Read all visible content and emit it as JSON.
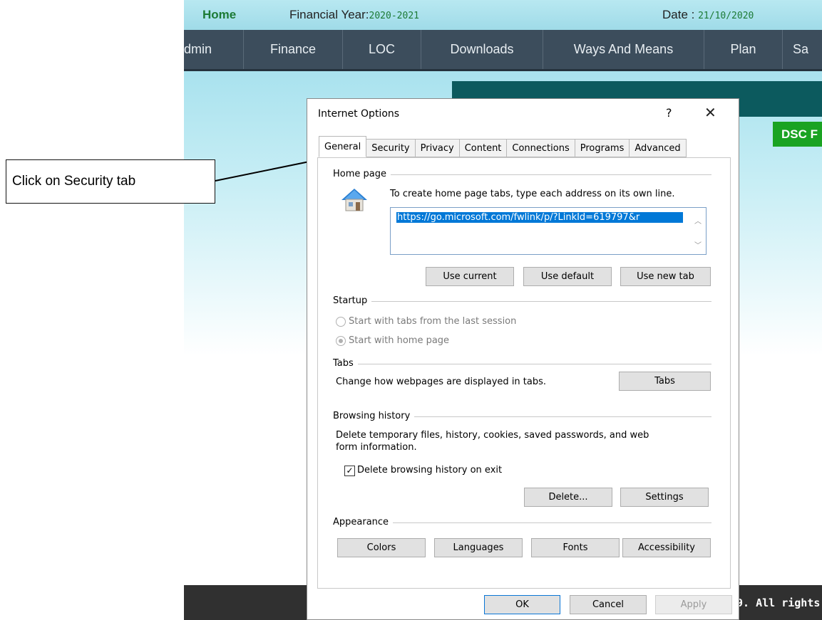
{
  "page": {
    "home": "Home",
    "financial_year_label": "Financial Year:",
    "financial_year_value": "2020-2021",
    "date_label": "Date : ",
    "date_value": "21/10/2020",
    "nav_items": [
      "dmin",
      "Finance",
      "LOC",
      "Downloads",
      "Ways And Means",
      "Plan",
      "Sa"
    ],
    "dsc_button": "DSC F",
    "footer_text": "9. All rights"
  },
  "annotation": {
    "text": "Click on Security tab"
  },
  "dialog": {
    "title": "Internet Options",
    "help": "?",
    "close": "✕",
    "tabs": [
      "General",
      "Security",
      "Privacy",
      "Content",
      "Connections",
      "Programs",
      "Advanced"
    ],
    "active_tab": "General",
    "home_page": {
      "group": "Home page",
      "hint": "To create home page tabs, type each address on its own line.",
      "url": "https://go.microsoft.com/fwlink/p/?LinkId=619797&r",
      "buttons": [
        "Use current",
        "Use default",
        "Use new tab"
      ]
    },
    "startup": {
      "group": "Startup",
      "option_last_session": "Start with tabs from the last session",
      "option_home_page": "Start with home page",
      "selected": "Start with home page"
    },
    "tabs_group": {
      "group": "Tabs",
      "description": "Change how webpages are displayed in tabs.",
      "button": "Tabs"
    },
    "browsing_history": {
      "group": "Browsing history",
      "description_line1": "Delete temporary files, history, cookies, saved passwords, and web",
      "description_line2": "form information.",
      "checkbox_label": "Delete browsing history on exit",
      "checkbox_checked": true,
      "delete_button": "Delete...",
      "settings_button": "Settings"
    },
    "appearance": {
      "group": "Appearance",
      "buttons": [
        "Colors",
        "Languages",
        "Fonts",
        "Accessibility"
      ]
    },
    "footer_buttons": {
      "ok": "OK",
      "cancel": "Cancel",
      "apply": "Apply"
    }
  }
}
